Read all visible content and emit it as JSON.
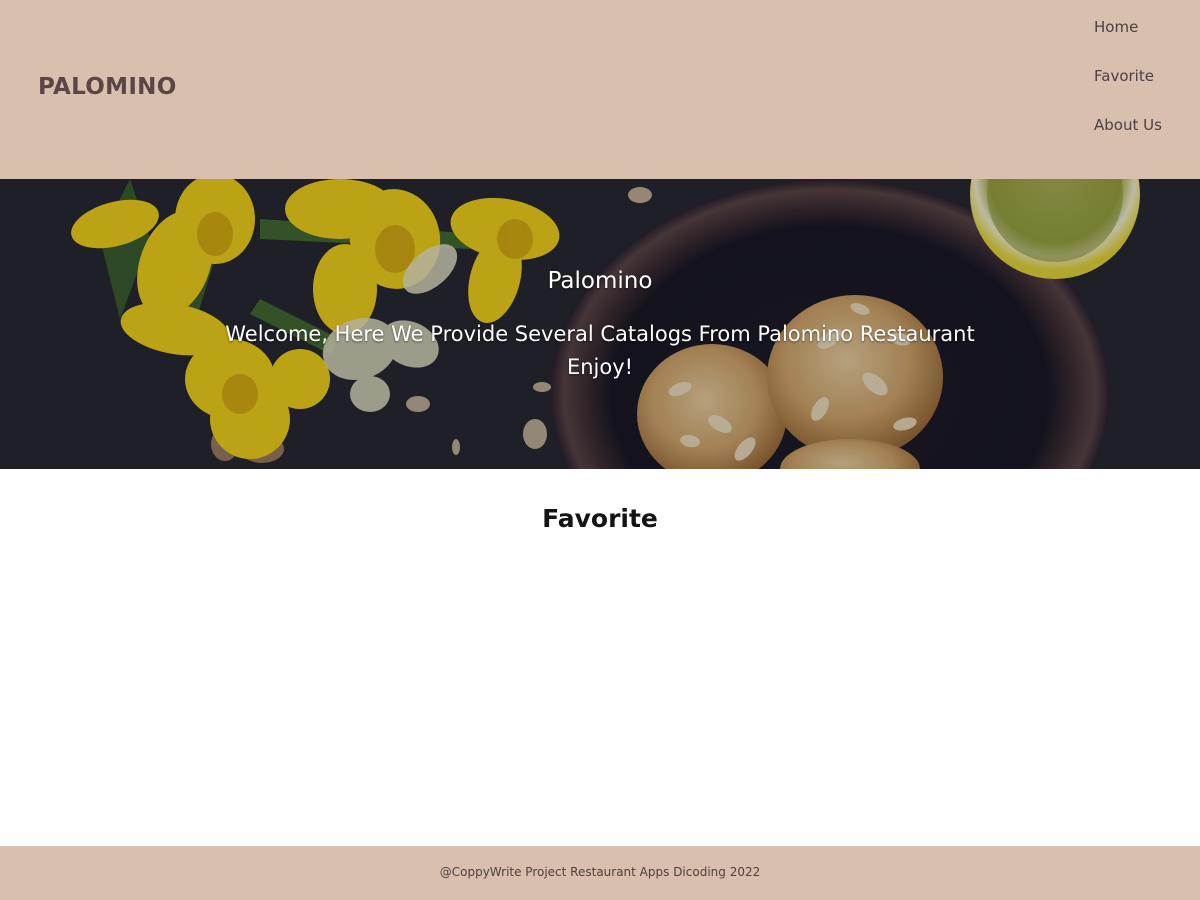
{
  "header": {
    "brand": "PALOMINO",
    "nav": [
      {
        "label": "Home"
      },
      {
        "label": "Favorite"
      },
      {
        "label": "About Us"
      }
    ]
  },
  "hero": {
    "title": "Palomino",
    "subtitle": "Welcome, Here We Provide Several Catalogs From Palomino Restaurant Enjoy!",
    "image_description_icon": "hero-food-image"
  },
  "main": {
    "section_title": "Favorite"
  },
  "footer": {
    "text": "@CoppyWrite Project Restaurant Apps Dicoding 2022"
  },
  "colors": {
    "header_bg": "#d9bfae",
    "brand_text": "#5b4545",
    "footer_bg": "#d9bfae"
  }
}
